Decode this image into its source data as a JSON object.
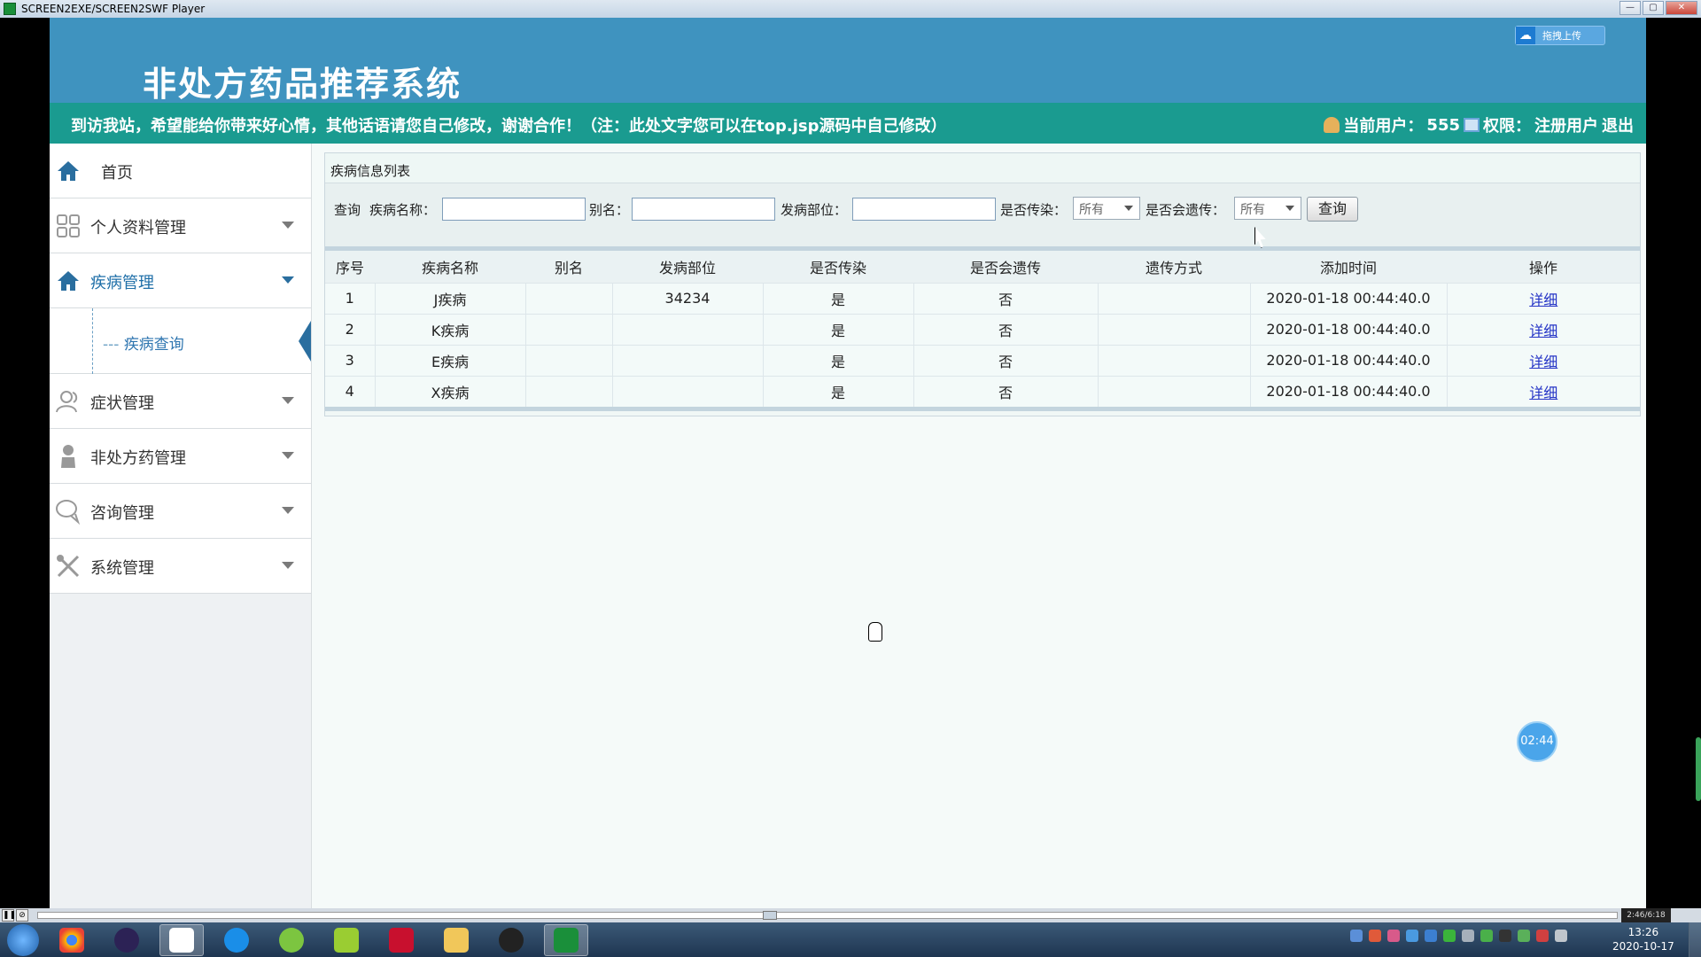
{
  "window": {
    "title": "SCREEN2EXE/SCREEN2SWF Player"
  },
  "header": {
    "system_title": "非处方药品推荐系统",
    "upload_button": "拖拽上传"
  },
  "notice": {
    "message": "到访我站，希望能给你带来好心情，其他话语请您自己修改，谢谢合作！（注：此处文字您可以在top.jsp源码中自己修改）",
    "current_user_label": "当前用户：",
    "current_user": "555",
    "permission_label": "权限：",
    "permission": "注册用户",
    "logout": "退出"
  },
  "sidebar": {
    "items": [
      {
        "label": "首页",
        "icon": "home-icon"
      },
      {
        "label": "个人资料管理",
        "icon": "grid-icon"
      },
      {
        "label": "疾病管理",
        "icon": "home-icon",
        "active": true
      },
      {
        "label": "症状管理",
        "icon": "users-icon"
      },
      {
        "label": "非处方药管理",
        "icon": "person-icon"
      },
      {
        "label": "咨询管理",
        "icon": "chat-icon"
      },
      {
        "label": "系统管理",
        "icon": "tools-icon"
      }
    ],
    "sub_items": [
      {
        "label": "疾病查询"
      }
    ]
  },
  "panel": {
    "title": "疾病信息列表",
    "search": {
      "query_label": "查询",
      "name_label": "疾病名称：",
      "alias_label": "别名：",
      "site_label": "发病部位：",
      "contagious_label": "是否传染：",
      "contagious_value": "所有",
      "hereditary_label": "是否会遗传：",
      "hereditary_value": "所有",
      "search_button": "查询"
    },
    "table": {
      "headers": [
        "序号",
        "疾病名称",
        "别名",
        "发病部位",
        "是否传染",
        "是否会遗传",
        "遗传方式",
        "添加时间",
        "操作"
      ],
      "rows": [
        [
          "1",
          "J疾病",
          "",
          "34234",
          "是",
          "否",
          "",
          "2020-01-18 00:44:40.0",
          "详细"
        ],
        [
          "2",
          "K疾病",
          "",
          "",
          "是",
          "否",
          "",
          "2020-01-18 00:44:40.0",
          "详细"
        ],
        [
          "3",
          "E疾病",
          "",
          "",
          "是",
          "否",
          "",
          "2020-01-18 00:44:40.0",
          "详细"
        ],
        [
          "4",
          "X疾病",
          "",
          "",
          "是",
          "否",
          "",
          "2020-01-18 00:44:40.0",
          "详细"
        ]
      ]
    }
  },
  "timer": "02:44",
  "player": {
    "time": "2:46/6:18"
  },
  "taskbar": {
    "time": "13:26",
    "date": "2020-10-17"
  },
  "colors": {
    "header": "#3f93bf",
    "notice_bar": "#1a9b90",
    "active_nav": "#1f6fa8"
  }
}
